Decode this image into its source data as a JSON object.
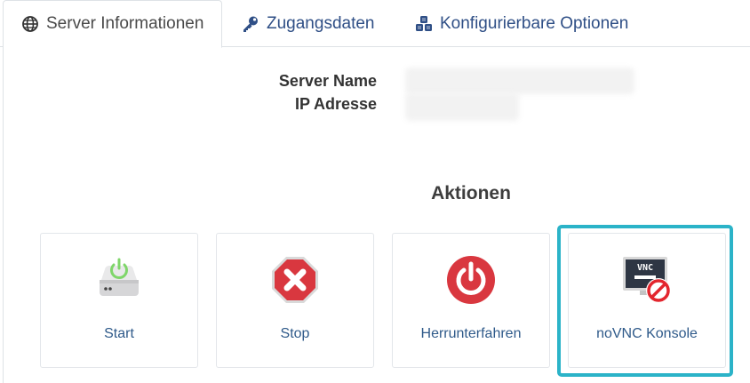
{
  "tabs": [
    {
      "label": "Server Informationen",
      "icon": "globe-icon",
      "active": true
    },
    {
      "label": "Zugangsdaten",
      "icon": "key-icon",
      "active": false
    },
    {
      "label": "Konfigurierbare Optionen",
      "icon": "cubes-icon",
      "active": false
    }
  ],
  "server_info": {
    "name_label": "Server Name",
    "ip_label": "IP Adresse"
  },
  "actions": {
    "title": "Aktionen",
    "items": [
      {
        "label": "Start",
        "icon": "power-on-server-icon"
      },
      {
        "label": "Stop",
        "icon": "stop-octagon-icon"
      },
      {
        "label": "Herrunterfahren",
        "icon": "power-off-icon"
      },
      {
        "label": "noVNC Konsole",
        "icon": "vnc-console-icon",
        "icon_text": "VNC"
      }
    ]
  },
  "colors": {
    "accent": "#2bb3c8",
    "link": "#2f5a8a",
    "stop": "#d9373f",
    "power_on": "#7fd66a"
  }
}
